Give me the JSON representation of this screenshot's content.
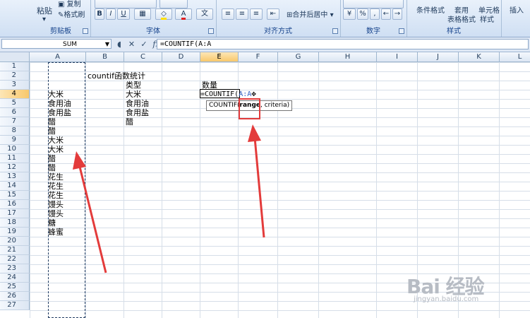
{
  "ribbon": {
    "paste": "粘贴",
    "copy": "复制",
    "format_painter": "格式刷",
    "clipboard": "剪贴板",
    "font": "字体",
    "alignment": "对齐方式",
    "merge_center": "合并后居中",
    "number": "数字",
    "conditional_format": "条件格式",
    "table_format_1": "套用",
    "table_format_2": "表格格式",
    "cell_style_1": "单元格",
    "cell_style_2": "样式",
    "styles": "样式",
    "insert": "插入",
    "bold": "B",
    "italic": "I",
    "underline": "U",
    "percent": "%"
  },
  "formula_bar": {
    "name_box": "SUM",
    "formula": "=COUNTIF(A:A"
  },
  "columns": [
    "A",
    "B",
    "C",
    "D",
    "E",
    "F",
    "G",
    "H",
    "I",
    "J",
    "K",
    "L",
    "M"
  ],
  "rows": [
    "1",
    "2",
    "3",
    "4",
    "5",
    "6",
    "7",
    "8",
    "9",
    "10",
    "11",
    "12",
    "13",
    "14",
    "15",
    "16",
    "17",
    "18",
    "19",
    "20",
    "21",
    "22",
    "23",
    "24",
    "25",
    "26",
    "27"
  ],
  "cells": {
    "B2": "countif函数统计",
    "C3": "类型",
    "E3": "数量",
    "C4": "大米",
    "C5": "食用油",
    "C6": "食用盐",
    "C7": "醋",
    "A4": "大米",
    "A5": "食用油",
    "A6": "食用盐",
    "A7": "醋",
    "A8": "醋",
    "A9": "大米",
    "A10": "大米",
    "A11": "醋",
    "A12": "醋",
    "A13": "花生",
    "A14": "花生",
    "A15": "花生",
    "A16": "馒头",
    "A17": "馒头",
    "A18": "糖",
    "A19": "蜂蜜"
  },
  "edit_cell": {
    "prefix": "=COUNTIF(",
    "ref": "A:A"
  },
  "tooltip": {
    "fn": "COUNTIF(",
    "arg1": "range",
    "rest": ", criteria)"
  },
  "watermark": {
    "logo": "Bai 经验",
    "url": "jingyan.baidu.com"
  },
  "colors": {
    "annotation_red": "#e33b3b",
    "ribbon_label": "#15428b",
    "active_header": "#f8c86c"
  }
}
